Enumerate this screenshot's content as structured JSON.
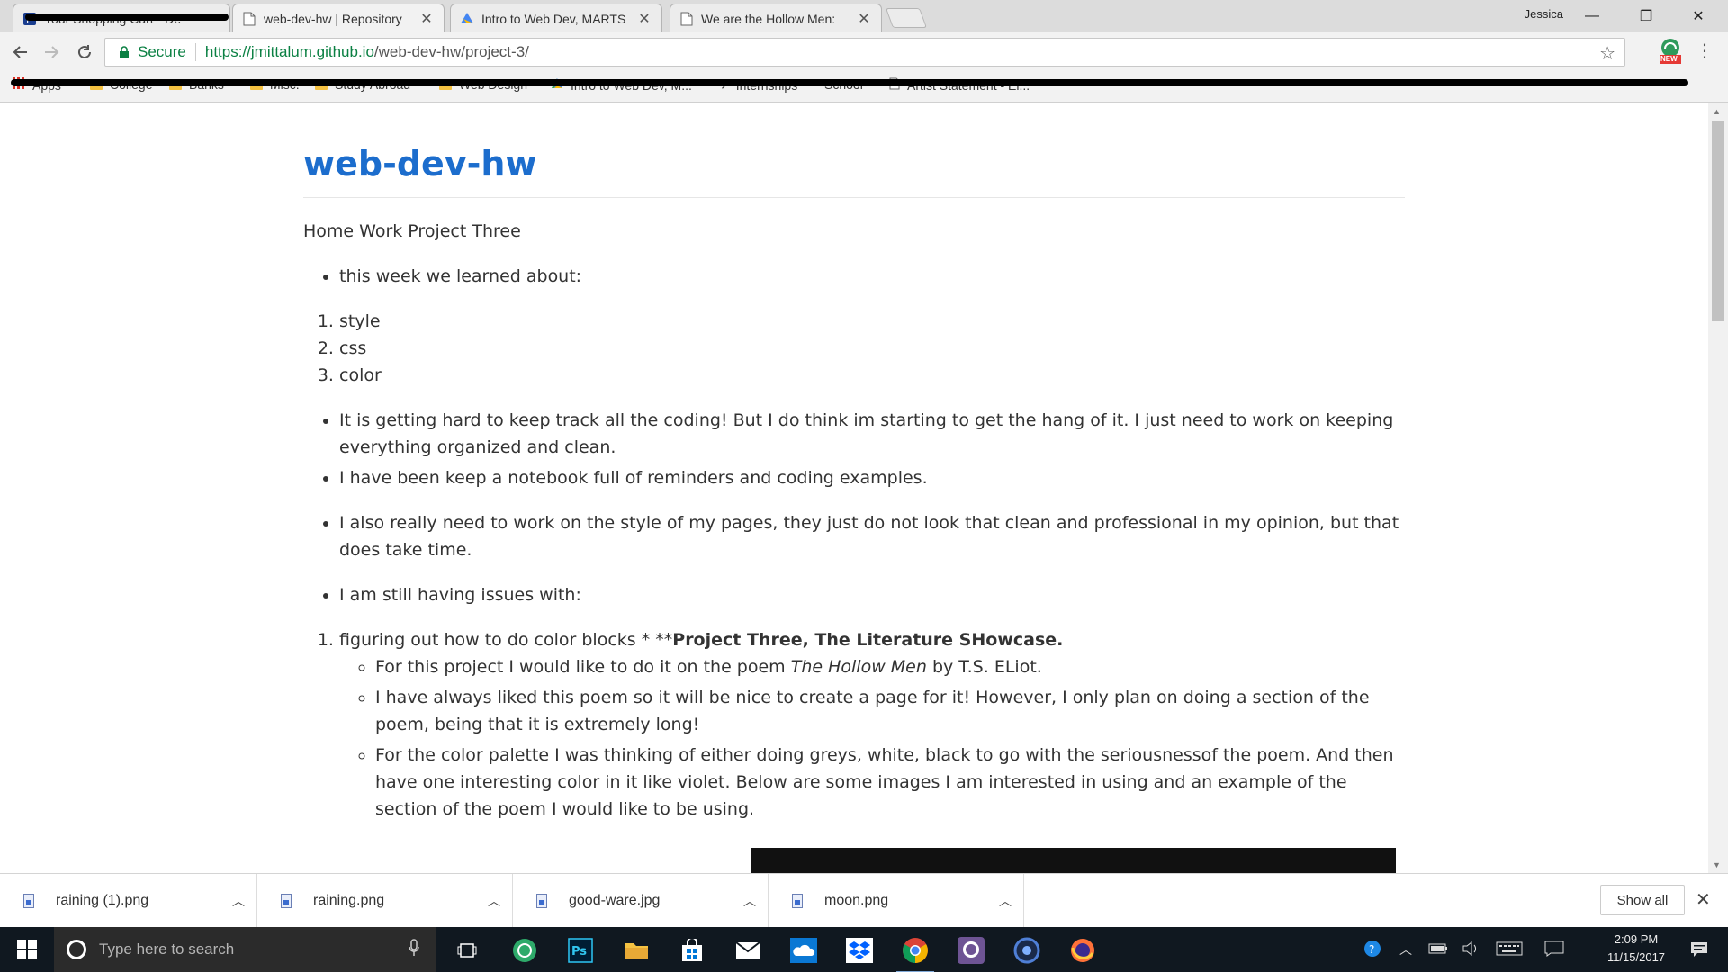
{
  "browser": {
    "tabs": [
      {
        "title": "Your Shopping Cart - De",
        "redacted": true
      },
      {
        "title": "web-dev-hw | Repository"
      },
      {
        "title": "Intro to Web Dev, MARTS"
      },
      {
        "title": "We are the Hollow Men:"
      }
    ],
    "profile_name": "Jessica",
    "omnibox": {
      "secure_label": "Secure",
      "url_base": "https://jmittalum.github.io",
      "url_path": "/web-dev-hw/project-3/"
    },
    "extension_badge": "NEW",
    "bookmarks": [
      "Apps",
      "College",
      "Banks",
      "Misc.",
      "Study Abroad",
      "Web Design",
      "Intro to Web Dev, M...",
      "Internships",
      "School",
      "Artist Statement - El..."
    ]
  },
  "page": {
    "title": "web-dev-hw",
    "intro": "Home Work Project Three",
    "bullet_learned": "this week we learned about:",
    "learned_items": [
      "style",
      "css",
      "color"
    ],
    "bullets_a": [
      "It is getting hard to keep track all the coding! But I do think im starting to get the hang of it. I just need to work on keeping everything organized and clean.",
      "I have been keep a notebook full of reminders and coding examples."
    ],
    "bullet_style": "I also really need to work on the style of my pages, they just do not look that clean and professional in my opinion, but that does take time.",
    "bullet_issues": "I am still having issues with:",
    "issue_item_prefix": "figuring out how to do color blocks * **",
    "issue_item_bold": "Project Three, The Literature SHowcase.",
    "sub_items": {
      "poem_prefix": "For this project I would like to do it on the poem ",
      "poem_title": "The Hollow Men",
      "poem_suffix": " by T.S. ELiot.",
      "liked": "I have always liked this poem so it will be nice to create a page for it! However, I only plan on doing a section of the poem, being that it is extremely long!",
      "palette": "For the color palette I was thinking of either doing greys, white, black to go with the seriousnessof the poem. And then have one interesting color in it like violet. Below are some images I am interested in using and an example of the section of the poem I would like to be using."
    }
  },
  "downloads": {
    "items": [
      "raining (1).png",
      "raining.png",
      "good-ware.jpg",
      "moon.png"
    ],
    "show_all": "Show all"
  },
  "taskbar": {
    "search_placeholder": "Type here to search",
    "clock_time": "2:09 PM",
    "clock_date": "11/15/2017"
  }
}
